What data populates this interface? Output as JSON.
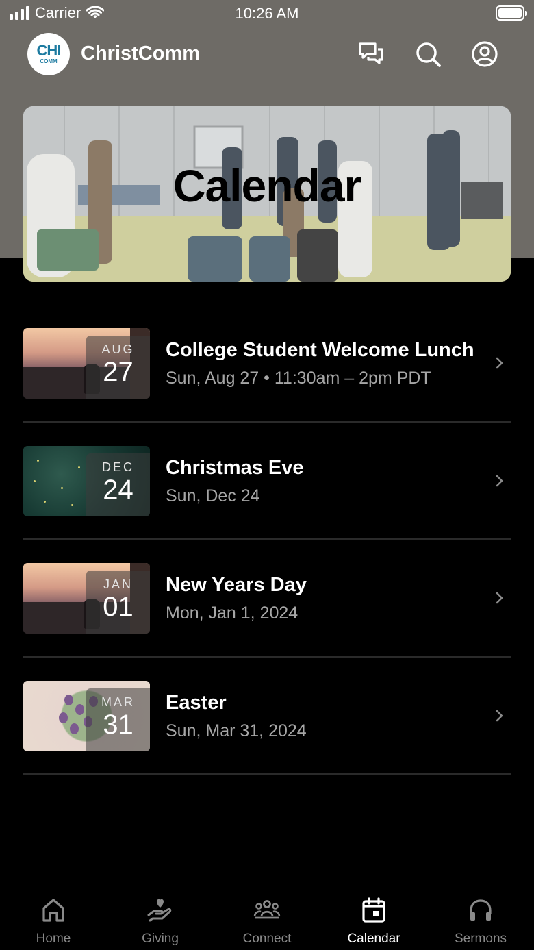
{
  "status_bar": {
    "carrier": "Carrier",
    "time": "10:26 AM"
  },
  "header": {
    "logo_line1": "CHI",
    "logo_line2": "COMM",
    "app_title": "ChristComm",
    "icons": [
      "chat-icon",
      "search-icon",
      "profile-icon"
    ]
  },
  "hero": {
    "title": "Calendar"
  },
  "events": [
    {
      "month": "AUG",
      "day": "27",
      "title": "College Student Welcome Lunch",
      "subtitle": "Sun, Aug 27 • 11:30am – 2pm PDT",
      "image": "sunset"
    },
    {
      "month": "DEC",
      "day": "24",
      "title": "Christmas Eve",
      "subtitle": "Sun, Dec 24",
      "image": "forest"
    },
    {
      "month": "JAN",
      "day": "01",
      "title": "New Years Day",
      "subtitle": "Mon, Jan 1, 2024",
      "image": "sunset"
    },
    {
      "month": "MAR",
      "day": "31",
      "title": "Easter",
      "subtitle": "Sun, Mar 31, 2024",
      "image": "flowers"
    }
  ],
  "tabbar": {
    "active": "calendar",
    "tabs": [
      {
        "id": "home",
        "label": "Home",
        "icon": "home-icon"
      },
      {
        "id": "giving",
        "label": "Giving",
        "icon": "giving-icon"
      },
      {
        "id": "connect",
        "label": "Connect",
        "icon": "group-icon"
      },
      {
        "id": "calendar",
        "label": "Calendar",
        "icon": "calendar-icon"
      },
      {
        "id": "sermons",
        "label": "Sermons",
        "icon": "headphones-icon"
      }
    ]
  },
  "colors": {
    "header_bg": "#6e6b66",
    "background": "#000000",
    "subtitle": "#a6a6a6",
    "tab_inactive": "#8a8a8a",
    "logo_blue": "#1c7aa0"
  }
}
